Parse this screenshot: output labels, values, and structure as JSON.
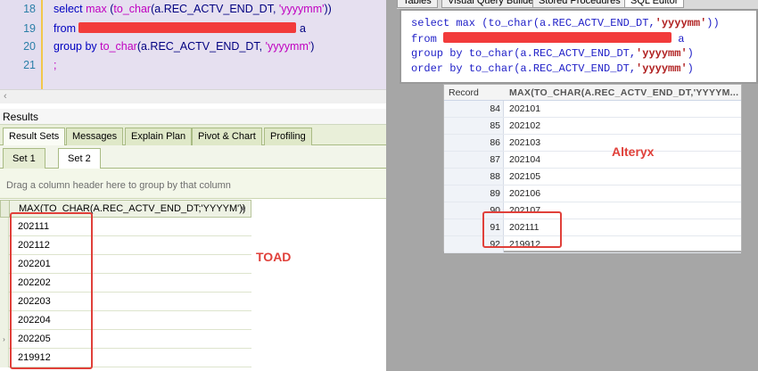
{
  "toad": {
    "editor": {
      "line_numbers": [
        "18",
        "19",
        "20",
        "21"
      ],
      "line18": {
        "kw": "select",
        "fn1": "max",
        "p1": " (",
        "fn2": "to_char",
        "p2": "(a.REC_ACTV_END_DT, ",
        "str": "'yyyymm'",
        "p3": "))"
      },
      "line19": {
        "kw": "from",
        "alias": "a"
      },
      "line20": {
        "kw": "group by",
        "fn": "to_char",
        "p1": "(a.REC_ACTV_END_DT, ",
        "str": "'yyyymm'",
        "p2": ")"
      },
      "line21": {
        "text": ";"
      }
    },
    "results_title": "Results",
    "result_tabs": [
      "Result Sets",
      "Messages",
      "Explain Plan",
      "Pivot & Chart",
      "Profiling"
    ],
    "set_tabs": [
      "Set 1",
      "Set 2"
    ],
    "group_hint": "Drag a column header here to group by that column",
    "grid": {
      "column": "MAX(TO_CHAR(A.REC_ACTV_END_DT;'YYYYM'))",
      "rows": [
        "202111",
        "202112",
        "202201",
        "202202",
        "202203",
        "202204",
        "202205",
        "219912"
      ]
    },
    "label": "TOAD"
  },
  "alteryx": {
    "tabs": [
      "Tables",
      "Visual Query Builder",
      "Stored Procedures",
      "SQL Editor"
    ],
    "sql": {
      "l1": {
        "a": "select max (to_char(a.REC_ACTV_END_DT,",
        "b": "'yyyymm'",
        "c": "))"
      },
      "l2": {
        "a": "from",
        "b": "a"
      },
      "l3": {
        "a": "group by to_char(a.REC_ACTV_END_DT,",
        "b": "'yyyymm'",
        "c": ")"
      },
      "l4": {
        "a": "order by to_char(a.REC_ACTV_END_DT,",
        "b": "'yyyymm'",
        "c": ")"
      }
    },
    "grid": {
      "col_record": "Record",
      "col_value": "MAX(TO_CHAR(A.REC_ACTV_END_DT,'YYYYM...",
      "rows": [
        {
          "record": "84",
          "value": "202101"
        },
        {
          "record": "85",
          "value": "202102"
        },
        {
          "record": "86",
          "value": "202103"
        },
        {
          "record": "87",
          "value": "202104"
        },
        {
          "record": "88",
          "value": "202105"
        },
        {
          "record": "89",
          "value": "202106"
        },
        {
          "record": "90",
          "value": "202107"
        },
        {
          "record": "91",
          "value": "202111"
        },
        {
          "record": "92",
          "value": "219912"
        }
      ]
    },
    "label": "Alteryx"
  },
  "colors": {
    "highlight": "#e0403a",
    "redaction": "#f23b3b",
    "toad_editor_bg": "#e6e0f0",
    "toad_grid_accent": "#a9bb84"
  }
}
